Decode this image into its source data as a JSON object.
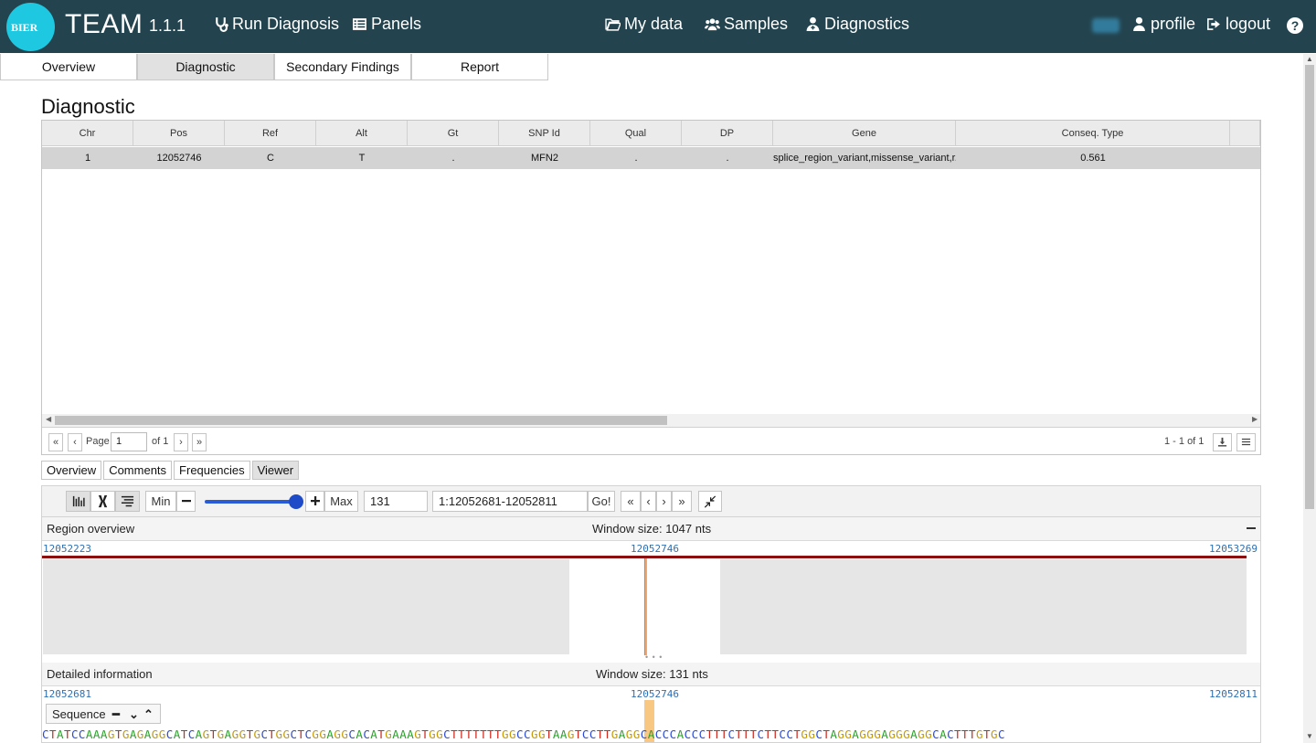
{
  "navbar": {
    "logo_text": "BIER",
    "brand": "TEAM",
    "version": "1.1.1",
    "left_items": [
      {
        "label": "Run Diagnosis",
        "icon": "stethoscope-icon"
      },
      {
        "label": "Panels",
        "icon": "list-alt-icon"
      }
    ],
    "center_items": [
      {
        "label": "My data",
        "icon": "folder-open-icon"
      },
      {
        "label": "Samples",
        "icon": "users-icon"
      },
      {
        "label": "Diagnostics",
        "icon": "user-md-icon"
      }
    ],
    "right_items": [
      {
        "label": "profile",
        "icon": "user-icon"
      },
      {
        "label": "logout",
        "icon": "sign-out-icon"
      }
    ],
    "help": "?"
  },
  "main_tabs": [
    "Overview",
    "Diagnostic",
    "Secondary Findings",
    "Report"
  ],
  "main_tab_active": "Diagnostic",
  "page_title": "Diagnostic",
  "grid": {
    "columns": [
      "Chr",
      "Pos",
      "Ref",
      "Alt",
      "Gt",
      "SNP Id",
      "Qual",
      "DP",
      "Gene",
      "Conseq. Type",
      ""
    ],
    "rows": [
      [
        "1",
        "12052746",
        "C",
        "T",
        ".",
        "MFN2",
        ".",
        ".",
        "splice_region_variant,missense_variant,r...",
        "0.561",
        ""
      ]
    ],
    "pager": {
      "first": "«",
      "prev": "‹",
      "page_label": "Page",
      "page_value": "1",
      "of_label": "of 1",
      "next": "›",
      "last": "»",
      "range": "1 - 1 of 1"
    }
  },
  "sub_tabs": [
    "Overview",
    "Comments",
    "Frequencies",
    "Viewer"
  ],
  "sub_tab_active": "Viewer",
  "viewer": {
    "toolbar": {
      "min_label": "Min",
      "max_label": "Max",
      "zoom_value": "131",
      "region_value": "1:12052681-12052811",
      "go_label": "Go!",
      "nav": [
        "«",
        "‹",
        "›",
        "»"
      ],
      "slider_level": 0.95
    },
    "region_overview": {
      "title": "Region overview",
      "window_size": "Window size: 1047 nts",
      "start": "12052223",
      "center": "12052746",
      "end": "12053269"
    },
    "detailed": {
      "title": "Detailed information",
      "window_size": "Window size: 131 nts",
      "start": "12052681",
      "center": "12052746",
      "end": "12052811"
    },
    "sequence_label": "Sequence",
    "sequence": "CTATCCAAAGTGAGAGGCATCAGTGAGGTGCTGGCTCGGAGGCACATGAAAGTGGCTTTTTTTGGCCGGTAAGTCCTTGAGGCACCCACCCTTTCTTTCTTCCTGGCTAGGAGGGAGGGAGGCACTTTGTGC"
  },
  "colors": {
    "navbar": "#23444f",
    "logo": "#1ec8e0",
    "base_A": "#2aa12a",
    "base_C": "#2b4bd6",
    "base_G": "#c59a00",
    "base_T": "#d0281d",
    "region_bar": "#8b0f0f",
    "variant_marker": "#f8c781"
  }
}
